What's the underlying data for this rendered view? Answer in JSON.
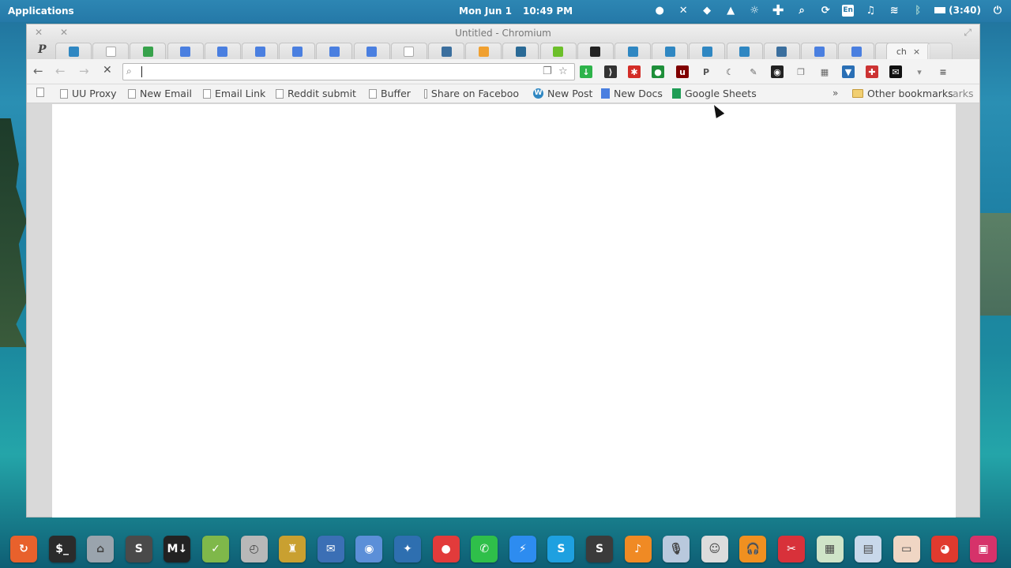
{
  "panel": {
    "applications_label": "Applications",
    "date": "Mon Jun  1",
    "time": "10:49 PM",
    "battery": "(3:40)",
    "lang": "En"
  },
  "window": {
    "title": "Untitled - Chromium"
  },
  "tabs": [
    {
      "icon": "wordpress-icon",
      "color": "#2f87c2"
    },
    {
      "icon": "blank-page-icon",
      "color": "#ffffff"
    },
    {
      "icon": "google-drive-icon",
      "color": "#37a24b"
    },
    {
      "icon": "google-docs-icon",
      "color": "#4a7fe0"
    },
    {
      "icon": "google-docs-icon",
      "color": "#4a7fe0"
    },
    {
      "icon": "google-docs-icon",
      "color": "#4a7fe0"
    },
    {
      "icon": "google-docs-icon",
      "color": "#4a7fe0"
    },
    {
      "icon": "google-docs-icon",
      "color": "#4a7fe0"
    },
    {
      "icon": "google-docs-icon",
      "color": "#4a7fe0"
    },
    {
      "icon": "blank-page-icon",
      "color": "#ffffff"
    },
    {
      "icon": "landscape-icon",
      "color": "#3b6f9e"
    },
    {
      "icon": "share-icon",
      "color": "#f0a030"
    },
    {
      "icon": "grid-icon",
      "color": "#2a6a96"
    },
    {
      "icon": "arrow-down-icon",
      "color": "#6cbf2a"
    },
    {
      "icon": "hashtag-icon",
      "color": "#222222"
    },
    {
      "icon": "wordpress-icon",
      "color": "#2f87c2"
    },
    {
      "icon": "wordpress-icon",
      "color": "#2f87c2"
    },
    {
      "icon": "wordpress-icon",
      "color": "#2f87c2"
    },
    {
      "icon": "wordpress-icon",
      "color": "#2f87c2"
    },
    {
      "icon": "bmj-icon",
      "color": "#3b6f9e"
    },
    {
      "icon": "google-g-icon",
      "color": "#4a7fe0"
    },
    {
      "icon": "google-g-icon",
      "color": "#4a7fe0"
    },
    {
      "icon": "blank-page-icon",
      "color": "#ffffff"
    }
  ],
  "active_tab": {
    "text": "ch",
    "close": "×"
  },
  "omnibox": {
    "value": "",
    "placeholder": ""
  },
  "bookmarks": [
    {
      "label": "UU Proxy",
      "icon": "page"
    },
    {
      "label": "New Email",
      "icon": "page"
    },
    {
      "label": "Email Link",
      "icon": "page"
    },
    {
      "label": "Reddit submit",
      "icon": "page"
    },
    {
      "label": "Buffer",
      "icon": "page"
    },
    {
      "label": "Share on Faceboo",
      "icon": "page"
    },
    {
      "label": "New Post",
      "icon": "wordpress"
    },
    {
      "label": "New Docs",
      "icon": "docs"
    },
    {
      "label": "Google Sheets",
      "icon": "sheets"
    }
  ],
  "bookmarks_more": "»",
  "other_bookmarks": "Other bookmarks",
  "bg_peek_text": "arks",
  "dock": [
    {
      "name": "update-manager-icon",
      "color": "#e8612c",
      "glyph": "↻"
    },
    {
      "name": "terminal-icon",
      "color": "#2b2b2b",
      "glyph": "$_"
    },
    {
      "name": "file-manager-icon",
      "color": "#9aa4ad",
      "glyph": "⌂"
    },
    {
      "name": "sublime-text-icon",
      "color": "#4a4a4a",
      "glyph": "S"
    },
    {
      "name": "markdown-editor-icon",
      "color": "#222222",
      "glyph": "M↓"
    },
    {
      "name": "clock-check-icon",
      "color": "#7fb84a",
      "glyph": "✓"
    },
    {
      "name": "stopwatch-icon",
      "color": "#b8b8b8",
      "glyph": "◴"
    },
    {
      "name": "gold-app-icon",
      "color": "#c9a030",
      "glyph": "♜"
    },
    {
      "name": "gmail-box-icon",
      "color": "#3b6fb5",
      "glyph": "✉"
    },
    {
      "name": "chromium-icon",
      "color": "#5b8fd8",
      "glyph": "◉"
    },
    {
      "name": "thunderbird-icon",
      "color": "#2e6fb0",
      "glyph": "✦"
    },
    {
      "name": "red-circle-app-icon",
      "color": "#e23b3b",
      "glyph": "●"
    },
    {
      "name": "whatsapp-icon",
      "color": "#2fbf4a",
      "glyph": "✆"
    },
    {
      "name": "messenger-icon",
      "color": "#2d8cf0",
      "glyph": "⚡"
    },
    {
      "name": "skype-icon",
      "color": "#1ea0e0",
      "glyph": "S"
    },
    {
      "name": "slack-icon",
      "color": "#3b3b3b",
      "glyph": "S"
    },
    {
      "name": "music-icon",
      "color": "#f08a24",
      "glyph": "♪"
    },
    {
      "name": "microphone-icon",
      "color": "#b9c9dd",
      "glyph": "🎙"
    },
    {
      "name": "robot-icon",
      "color": "#dcdcdc",
      "glyph": "☺"
    },
    {
      "name": "headphones-icon",
      "color": "#f09020",
      "glyph": "🎧"
    },
    {
      "name": "screenshot-icon",
      "color": "#d8313a",
      "glyph": "✂"
    },
    {
      "name": "spreadsheet-icon",
      "color": "#cfe4c8",
      "glyph": "▦"
    },
    {
      "name": "document-icon",
      "color": "#c8d8ea",
      "glyph": "▤"
    },
    {
      "name": "presentation-icon",
      "color": "#f0d6c4",
      "glyph": "▭"
    },
    {
      "name": "disk-usage-icon",
      "color": "#e03a2e",
      "glyph": "◕"
    },
    {
      "name": "screen-switch-icon",
      "color": "#d6326a",
      "glyph": "▣"
    }
  ]
}
